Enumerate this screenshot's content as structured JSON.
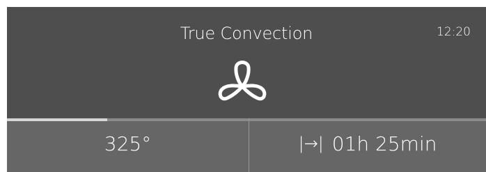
{
  "mode": {
    "title": "True Convection",
    "icon": "fan-icon"
  },
  "clock": "12:20",
  "progress": {
    "fraction": 0.21
  },
  "temperature": "325°",
  "timer": {
    "icon": "end-time-icon",
    "icon_glyph": "|→|",
    "duration": "01h 25min"
  },
  "colors": {
    "panel": "#4e4e4e",
    "bottom": "#666666",
    "text": "#ffffff",
    "progress": "#d6d6d6"
  }
}
